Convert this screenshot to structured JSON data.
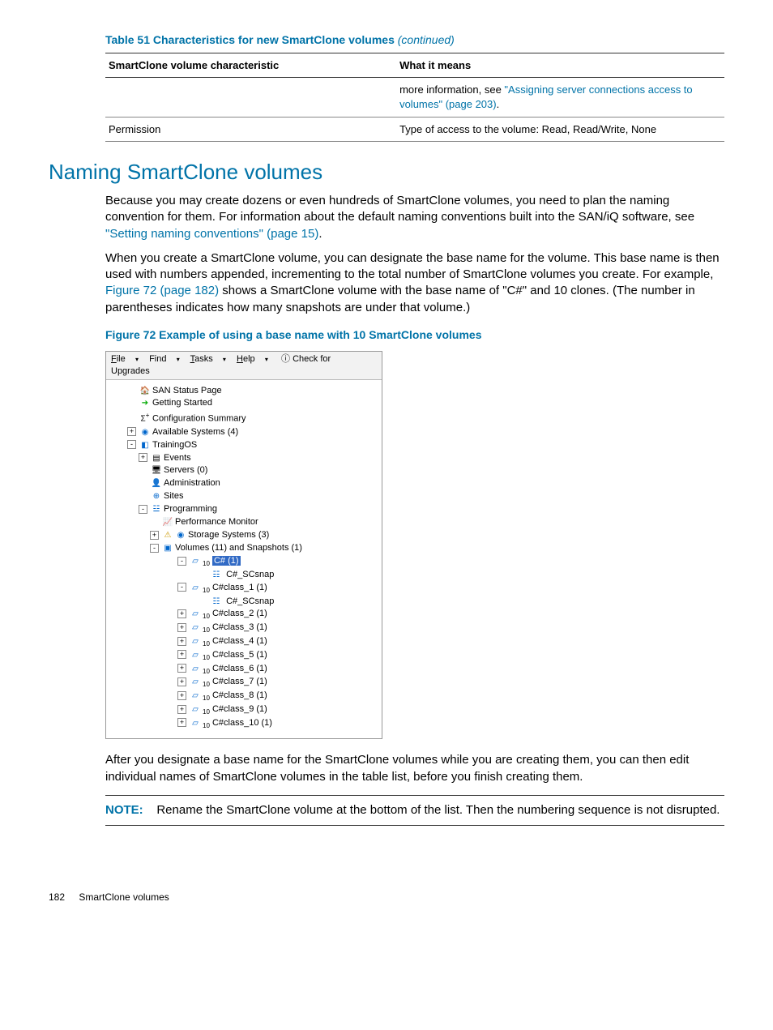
{
  "table": {
    "caption_strong": "Table 51 Characteristics for new SmartClone volumes",
    "caption_cont": "(continued)",
    "head_left": "SmartClone volume characteristic",
    "head_right": "What it means",
    "row0_right_pre": "more information, see ",
    "row0_right_link": "\"Assigning server connections access to volumes\" (page 203)",
    "row0_right_post": ".",
    "row1_left": "Permission",
    "row1_right": "Type of access to the volume: Read, Read/Write, None"
  },
  "section_heading": "Naming SmartClone volumes",
  "para1_a": "Because you may create dozens or even hundreds of SmartClone volumes, you need to plan the naming convention for them. For information about the default naming conventions built into the SAN/iQ software, see ",
  "para1_link": "\"Setting naming conventions\" (page 15)",
  "para1_b": ".",
  "para2_a": "When you create a SmartClone volume, you can designate the base name for the volume. This base name is then used with numbers appended, incrementing to the total number of SmartClone volumes you create. For example, ",
  "para2_link": "Figure 72 (page 182)",
  "para2_b": " shows a SmartClone volume with the base name of \"C#\" and 10 clones. (The number in parentheses indicates how many snapshots are under that volume.)",
  "fig_caption": "Figure 72 Example of using a base name with 10 SmartClone volumes",
  "menu": {
    "file": "ile",
    "find": "Find",
    "tasks": "asks",
    "help": "elp",
    "upgrades": "Check for Upgrades"
  },
  "tree": {
    "n_san": "SAN Status Page",
    "n_getting": "Getting Started",
    "n_config": "Configuration Summary",
    "n_avail": "Available Systems (4)",
    "n_training": "TrainingOS",
    "n_events": "Events",
    "n_servers": "Servers (0)",
    "n_admin": "Administration",
    "n_sites": "Sites",
    "n_prog": "Programming",
    "n_perf": "Performance Monitor",
    "n_storage": "Storage Systems (3)",
    "n_vols": "Volumes (11) and Snapshots (1)",
    "v_c": "C# (1)",
    "v_c_snap": "C#_SCsnap",
    "v_c1": "C#class_1 (1)",
    "v_c1_snap": "C#_SCsnap",
    "v_c2": "C#class_2 (1)",
    "v_c3": "C#class_3 (1)",
    "v_c4": "C#class_4 (1)",
    "v_c5": "C#class_5 (1)",
    "v_c6": "C#class_6 (1)",
    "v_c7": "C#class_7 (1)",
    "v_c8": "C#class_8 (1)",
    "v_c9": "C#class_9 (1)",
    "v_c10": "C#class_10 (1)"
  },
  "para3": "After you designate a base name for the SmartClone volumes while you are creating them, you can then edit individual names of SmartClone volumes in the table list, before you finish creating them.",
  "note_label": "NOTE:",
  "note_text": "Rename the SmartClone volume at the bottom of the list. Then the numbering sequence is not disrupted.",
  "footer_page": "182",
  "footer_section": "SmartClone volumes"
}
